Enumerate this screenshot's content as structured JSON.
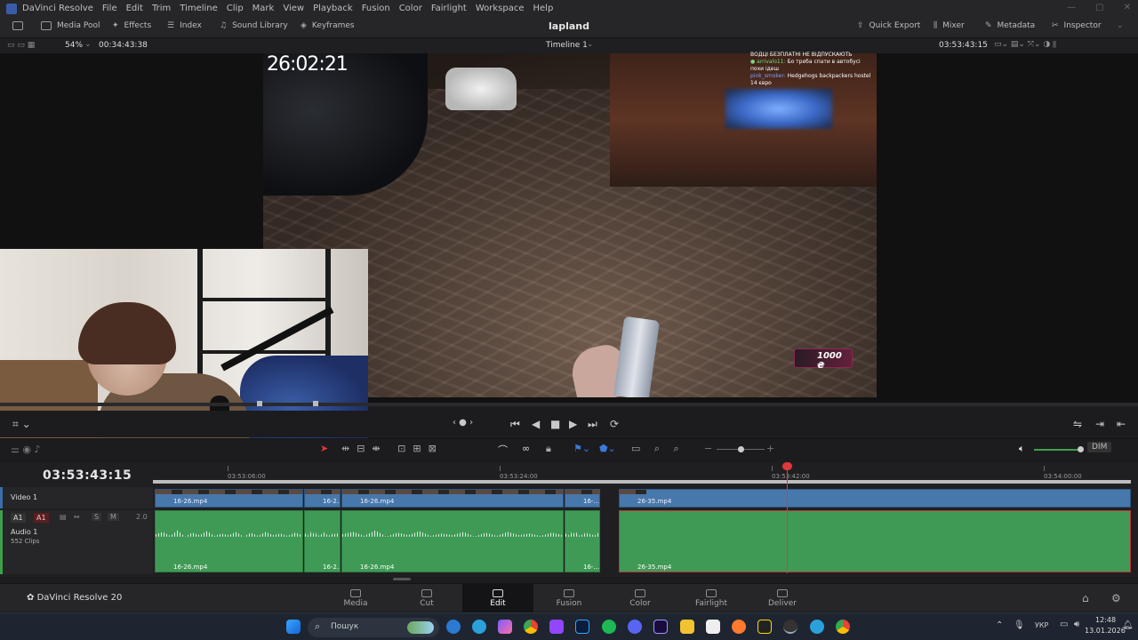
{
  "menubar": {
    "app_name": "DaVinci Resolve",
    "items": [
      "File",
      "Edit",
      "Trim",
      "Timeline",
      "Clip",
      "Mark",
      "View",
      "Playback",
      "Fusion",
      "Color",
      "Fairlight",
      "Workspace",
      "Help"
    ]
  },
  "toolbar": {
    "media_pool": "Media Pool",
    "effects": "Effects",
    "index": "Index",
    "sound_library": "Sound Library",
    "keyframes": "Keyframes",
    "project_title": "lapland",
    "quick_export": "Quick Export",
    "mixer": "Mixer",
    "metadata": "Metadata",
    "inspector": "Inspector"
  },
  "viewer": {
    "zoom": "54%",
    "source_timecode": "00:34:43:38",
    "timeline_name": "Timeline 1",
    "record_timecode": "03:53:43:15",
    "overlay_timer": "26:02:21",
    "chat_lines": [
      {
        "user": "",
        "text": "ВОДЦІ БЕЗПЛАТНІ НЕ ВІДПУСКАЮТЬ"
      },
      {
        "user": "● arrivalo11:",
        "text": "Бо треба спати в автобусі похи ідеш"
      },
      {
        "user": "pink_smoker:",
        "text": "Hedgehogs backpackers hostel 14 євро"
      }
    ],
    "badge_text": "1000 ₴"
  },
  "timeline": {
    "current_timecode": "03:53:43:15",
    "ruler_labels": [
      "03:53:06:00",
      "03:53:24:00",
      "03:53:42:00",
      "03:54:00:00"
    ],
    "video_track": {
      "name": "Video 1",
      "id": "V1"
    },
    "audio_track": {
      "name": "Audio 1",
      "clip_count": "552 Clips",
      "id_a": "A1",
      "id_b": "A1",
      "solo": "S",
      "mute": "M",
      "level": "2.0"
    },
    "video_clips": [
      "16-26.mp4",
      "16-2...",
      "16-26.mp4",
      "16-...",
      "26-35.mp4"
    ],
    "audio_clips": [
      "16-26.mp4",
      "16-2...",
      "16-26.mp4",
      "16-...",
      "26-35.mp4"
    ],
    "dim_label": "DIM"
  },
  "pages": {
    "brand": "DaVinci Resolve 20",
    "tabs": [
      "Media",
      "Cut",
      "Edit",
      "Fusion",
      "Color",
      "Fairlight",
      "Deliver"
    ],
    "active": "Edit"
  },
  "taskbar": {
    "search_placeholder": "Пошук",
    "language": "УКР",
    "time": "12:48",
    "date": "13.01.2026"
  },
  "colors": {
    "accent_red": "#e0383b",
    "video_clip": "#4778ab",
    "audio_clip": "#3f9a55",
    "background": "#1c1c1e"
  }
}
